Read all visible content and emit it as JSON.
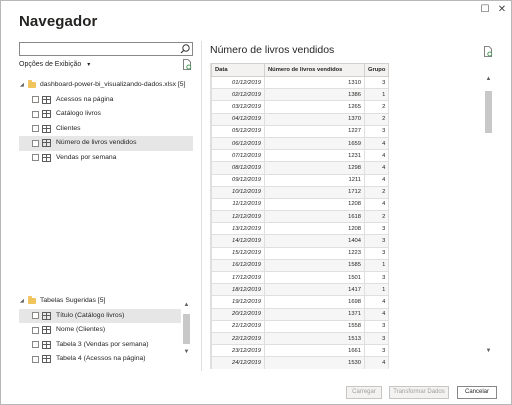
{
  "window": {
    "title": "Navegador",
    "restore_glyph": "☐",
    "close_glyph": "✕"
  },
  "left_panel": {
    "search": {
      "value": "",
      "placeholder": ""
    },
    "options_label": "Opções de Exibição",
    "options_caret": "▾",
    "source_node": {
      "caret": "◢",
      "label": "dashboard-power-bi_visualizando-dados.xlsx [5]",
      "items": [
        {
          "label": "Acessos na página"
        },
        {
          "label": "Catálogo livros"
        },
        {
          "label": "Clientes"
        },
        {
          "label": "Número de livros vendidos",
          "selected": true
        },
        {
          "label": "Vendas por semana"
        }
      ]
    },
    "suggested_node": {
      "caret": "◢",
      "label": "Tabelas Sugeridas [5]",
      "items": [
        {
          "label": "Título (Catálogo livros)",
          "selected": true
        },
        {
          "label": "Nome (Clientes)"
        },
        {
          "label": "Tabela 3 (Vendas por semana)"
        },
        {
          "label": "Tabela 4 (Acessos na página)"
        }
      ]
    },
    "scroll": {
      "up": "▲",
      "down": "▼"
    }
  },
  "preview": {
    "title": "Número de livros vendidos",
    "columns": [
      "Data",
      "Número de livros vendidos",
      "Grupo"
    ],
    "rows": [
      [
        "01/12/2019",
        "1310",
        "3"
      ],
      [
        "02/12/2019",
        "1386",
        "1"
      ],
      [
        "03/12/2019",
        "1265",
        "2"
      ],
      [
        "04/12/2019",
        "1370",
        "2"
      ],
      [
        "05/12/2019",
        "1227",
        "3"
      ],
      [
        "06/12/2019",
        "1659",
        "4"
      ],
      [
        "07/12/2019",
        "1231",
        "4"
      ],
      [
        "08/12/2019",
        "1298",
        "4"
      ],
      [
        "09/12/2019",
        "1211",
        "4"
      ],
      [
        "10/12/2019",
        "1712",
        "2"
      ],
      [
        "11/12/2019",
        "1208",
        "4"
      ],
      [
        "12/12/2019",
        "1618",
        "2"
      ],
      [
        "13/12/2019",
        "1208",
        "3"
      ],
      [
        "14/12/2019",
        "1404",
        "3"
      ],
      [
        "15/12/2019",
        "1223",
        "3"
      ],
      [
        "16/12/2019",
        "1585",
        "1"
      ],
      [
        "17/12/2019",
        "1501",
        "3"
      ],
      [
        "18/12/2019",
        "1417",
        "1"
      ],
      [
        "19/12/2019",
        "1698",
        "4"
      ],
      [
        "20/12/2019",
        "1371",
        "4"
      ],
      [
        "21/12/2019",
        "1558",
        "3"
      ],
      [
        "22/12/2019",
        "1513",
        "3"
      ],
      [
        "23/12/2019",
        "1661",
        "3"
      ],
      [
        "24/12/2019",
        "1530",
        "4"
      ]
    ],
    "scroll": {
      "up": "▲",
      "down": "▼"
    }
  },
  "footer": {
    "load_label": "Carregar",
    "transform_label": "Transformar Dados",
    "cancel_label": "Cancelar"
  }
}
